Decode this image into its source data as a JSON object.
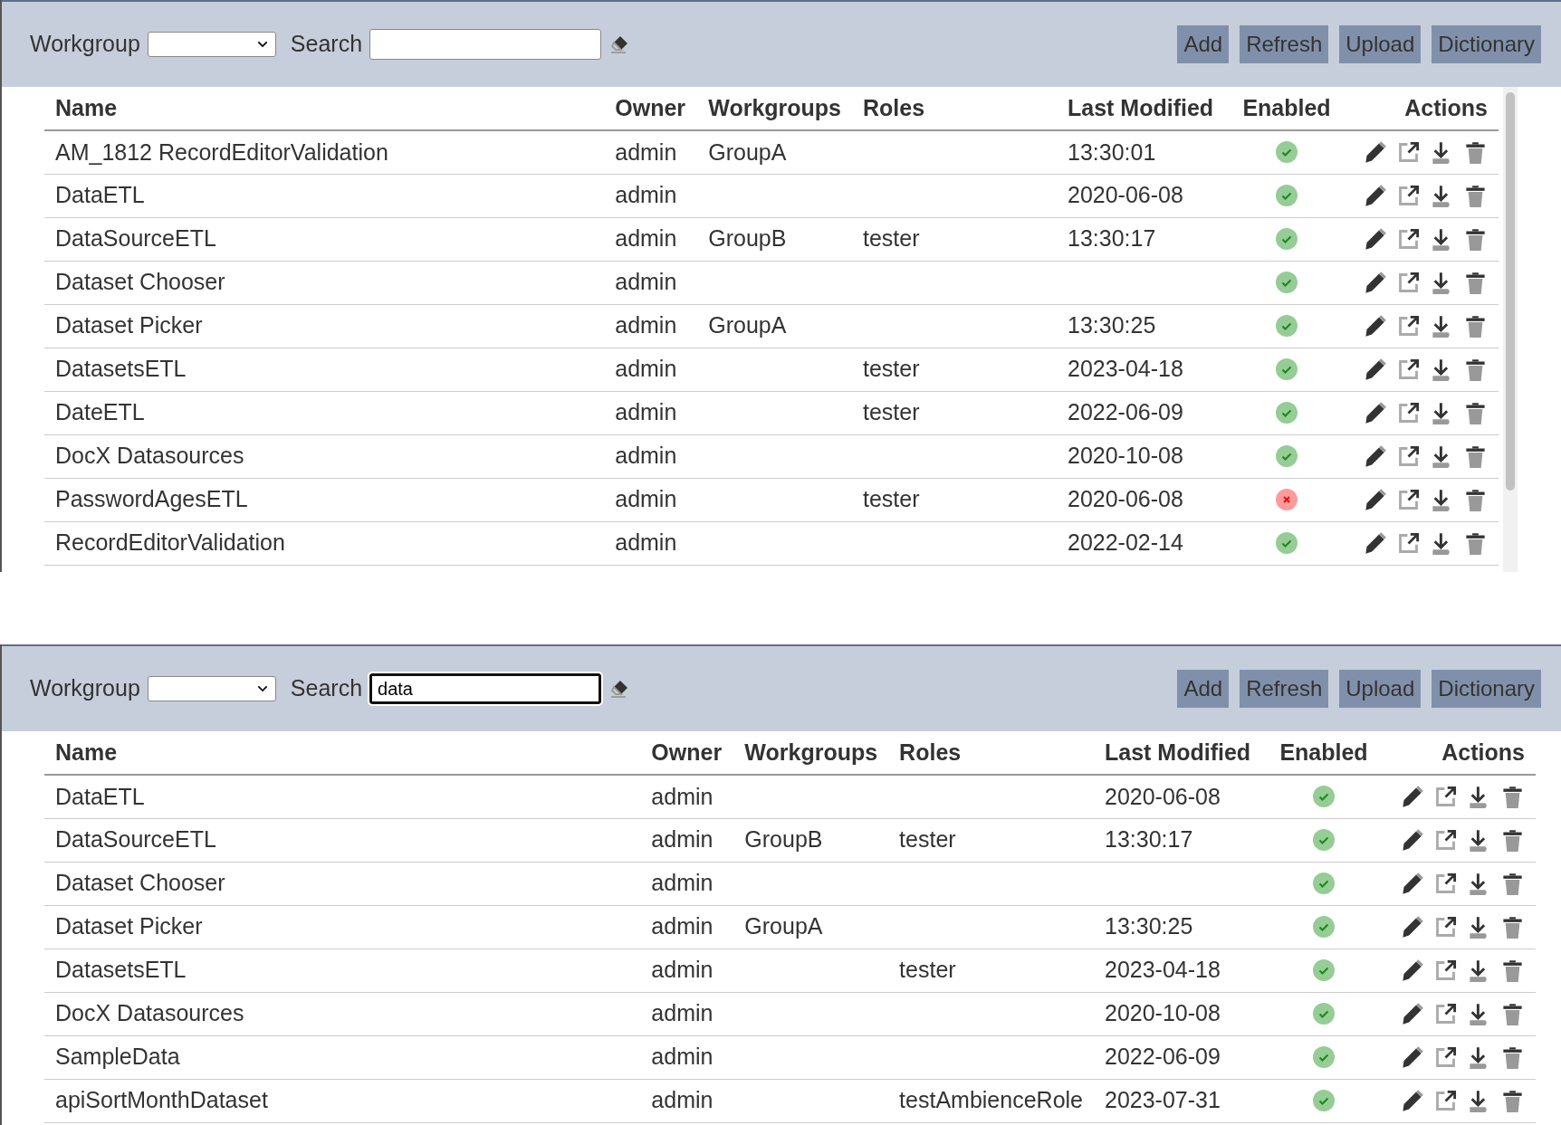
{
  "panels": [
    {
      "toolbar": {
        "workgroup_label": "Workgroup",
        "search_label": "Search",
        "search_focused": false,
        "buttons": [
          "Add",
          "Refresh",
          "Upload",
          "Dictionary"
        ]
      },
      "scrollbar": true,
      "table": {
        "columns": [
          "Name",
          "Owner",
          "Workgroups",
          "Roles",
          "Last Modified",
          "Enabled",
          "Actions"
        ],
        "rows": [
          {
            "name": "AM_1812 RecordEditorValidation",
            "owner": "admin",
            "workgroups": "GroupA",
            "last_modified": "13:30:01",
            "enabled": true
          },
          {
            "name": "DataETL",
            "owner": "admin",
            "last_modified": "2020-06-08",
            "enabled": true
          },
          {
            "name": "DataSourceETL",
            "owner": "admin",
            "workgroups": "GroupB",
            "roles": "tester",
            "last_modified": "13:30:17",
            "enabled": true
          },
          {
            "name": "Dataset Chooser",
            "owner": "admin",
            "enabled": true
          },
          {
            "name": "Dataset Picker",
            "owner": "admin",
            "workgroups": "GroupA",
            "last_modified": "13:30:25",
            "enabled": true
          },
          {
            "name": "DatasetsETL",
            "owner": "admin",
            "roles": "tester",
            "last_modified": "2023-04-18",
            "enabled": true
          },
          {
            "name": "DateETL",
            "owner": "admin",
            "roles": "tester",
            "last_modified": "2022-06-09",
            "enabled": true
          },
          {
            "name": "DocX Datasources",
            "owner": "admin",
            "last_modified": "2020-10-08",
            "enabled": true
          },
          {
            "name": "PasswordAgesETL",
            "owner": "admin",
            "roles": "tester",
            "last_modified": "2020-06-08",
            "enabled": false
          },
          {
            "name": "RecordEditorValidation",
            "owner": "admin",
            "last_modified": "2022-02-14",
            "enabled": true
          }
        ]
      }
    },
    {
      "toolbar": {
        "workgroup_label": "Workgroup",
        "search_label": "Search",
        "search_value": "data",
        "search_focused": true,
        "buttons": [
          "Add",
          "Refresh",
          "Upload",
          "Dictionary"
        ]
      },
      "scrollbar": false,
      "table": {
        "columns": [
          "Name",
          "Owner",
          "Workgroups",
          "Roles",
          "Last Modified",
          "Enabled",
          "Actions"
        ],
        "rows": [
          {
            "name": "DataETL",
            "owner": "admin",
            "last_modified": "2020-06-08",
            "enabled": true
          },
          {
            "name": "DataSourceETL",
            "owner": "admin",
            "workgroups": "GroupB",
            "roles": "tester",
            "last_modified": "13:30:17",
            "enabled": true
          },
          {
            "name": "Dataset Chooser",
            "owner": "admin",
            "enabled": true
          },
          {
            "name": "Dataset Picker",
            "owner": "admin",
            "workgroups": "GroupA",
            "last_modified": "13:30:25",
            "enabled": true
          },
          {
            "name": "DatasetsETL",
            "owner": "admin",
            "roles": "tester",
            "last_modified": "2023-04-18",
            "enabled": true
          },
          {
            "name": "DocX Datasources",
            "owner": "admin",
            "last_modified": "2020-10-08",
            "enabled": true
          },
          {
            "name": "SampleData",
            "owner": "admin",
            "last_modified": "2022-06-09",
            "enabled": true
          },
          {
            "name": "apiSortMonthDataset",
            "owner": "admin",
            "roles": "testAmbienceRole",
            "last_modified": "2023-07-31",
            "enabled": true
          }
        ]
      }
    }
  ]
}
